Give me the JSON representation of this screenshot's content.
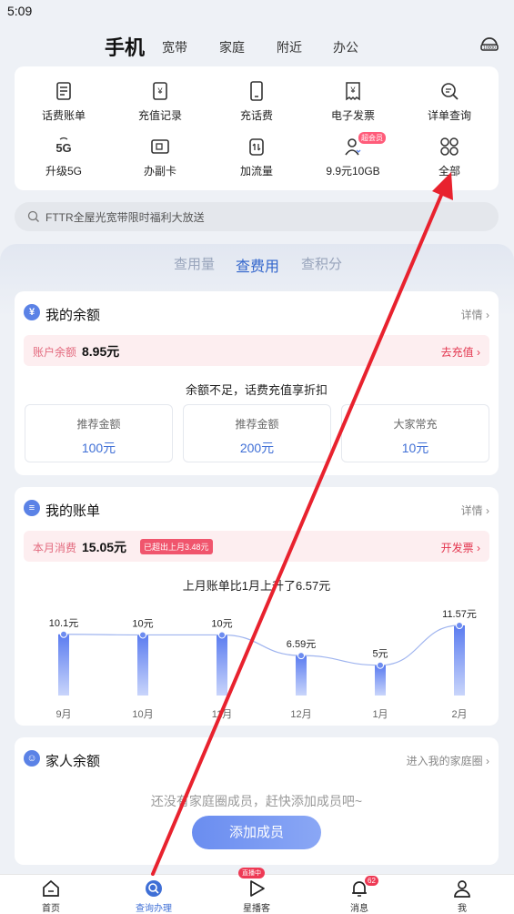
{
  "status": {
    "time": "5:09"
  },
  "nav": {
    "main": "手机",
    "tabs": [
      "宽带",
      "家庭",
      "附近",
      "办公"
    ]
  },
  "quick": [
    {
      "label": "话费账单",
      "icon": "bill-icon"
    },
    {
      "label": "充值记录",
      "icon": "recharge-record-icon"
    },
    {
      "label": "充话费",
      "icon": "phone-topup-icon"
    },
    {
      "label": "电子发票",
      "icon": "invoice-icon"
    },
    {
      "label": "详单查询",
      "icon": "detail-search-icon"
    },
    {
      "label": "升级5G",
      "icon": "5g-icon"
    },
    {
      "label": "办副卡",
      "icon": "sim-card-icon"
    },
    {
      "label": "加流量",
      "icon": "data-add-icon"
    },
    {
      "label": "9.9元10GB",
      "icon": "member-icon",
      "badge": "超会员"
    },
    {
      "label": "全部",
      "icon": "all-apps-icon"
    }
  ],
  "search": {
    "placeholder": "FTTR全屋光宽带限时福利大放送"
  },
  "segments": [
    "查用量",
    "查费用",
    "查积分"
  ],
  "balance": {
    "title": "我的余额",
    "detail": "详情",
    "account_label": "账户余额",
    "account_value": "8.95元",
    "recharge": "去充值",
    "notice": "余额不足，话费充值享折扣",
    "options": [
      {
        "title": "推荐金额",
        "amount": "100元"
      },
      {
        "title": "推荐金额",
        "amount": "200元"
      },
      {
        "title": "大家常充",
        "amount": "10元"
      }
    ]
  },
  "bill": {
    "title": "我的账单",
    "detail": "详情",
    "month_label": "本月消费",
    "month_value": "15.05元",
    "over_tag": "已超出上月3.48元",
    "invoice": "开发票",
    "summary": "上月账单比1月上升了6.57元"
  },
  "chart_data": {
    "type": "bar",
    "categories": [
      "9月",
      "10月",
      "11月",
      "12月",
      "1月",
      "2月"
    ],
    "values": [
      10.1,
      10,
      10,
      6.59,
      5,
      11.57
    ],
    "data_labels": [
      "10.1元",
      "10元",
      "10元",
      "6.59元",
      "5元",
      "11.57元"
    ],
    "ylim": [
      0,
      11.57
    ]
  },
  "family": {
    "title": "家人余额",
    "link": "进入我的家庭圈",
    "empty": "还没有家庭圈成员，赶快添加成员吧~",
    "button": "添加成员"
  },
  "tabbar": {
    "items": [
      {
        "label": "首页",
        "icon": "home-icon"
      },
      {
        "label": "查询办理",
        "icon": "query-icon"
      },
      {
        "label": "星播客",
        "icon": "play-icon",
        "tag": "直播中"
      },
      {
        "label": "消息",
        "icon": "bell-icon",
        "count": "62"
      },
      {
        "label": "我",
        "icon": "person-icon"
      }
    ]
  },
  "colors": {
    "accent": "#3f6fd6",
    "annotation_arrow": "#e8222e"
  }
}
